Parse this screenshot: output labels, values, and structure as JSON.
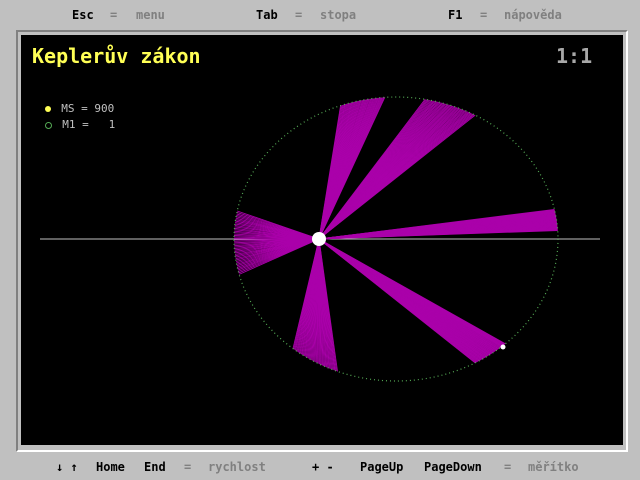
{
  "top_bar": {
    "esc_key": "Esc",
    "esc_eq": "=",
    "esc_label": "menu",
    "tab_key": "Tab",
    "tab_eq": "=",
    "tab_label": "stopa",
    "f1_key": "F1",
    "f1_eq": "=",
    "f1_label": "nápověda"
  },
  "bottom_bar": {
    "arrows": "↓ ↑",
    "home": "Home",
    "end": "End",
    "speed_eq": "=",
    "speed_label": "rychlost",
    "plus_minus": "+ -",
    "pageup": "PageUp",
    "pagedown": "PageDown",
    "scale_eq": "=",
    "scale_label": "měřítko"
  },
  "title": "Keplerův zákon",
  "scale_readout": "1:1",
  "masses": {
    "ms_label": "MS = 900",
    "m1_label": "M1 =   1"
  },
  "colors": {
    "title": "#ffff55",
    "sweep": "#aa00aa",
    "orbit": "#55aa55",
    "sun": "#ffffff",
    "ms_marker": "#ffff55",
    "m1_marker": "#55aa55"
  },
  "icons": {
    "sun": "star-icon",
    "planet": "planet-icon"
  }
}
